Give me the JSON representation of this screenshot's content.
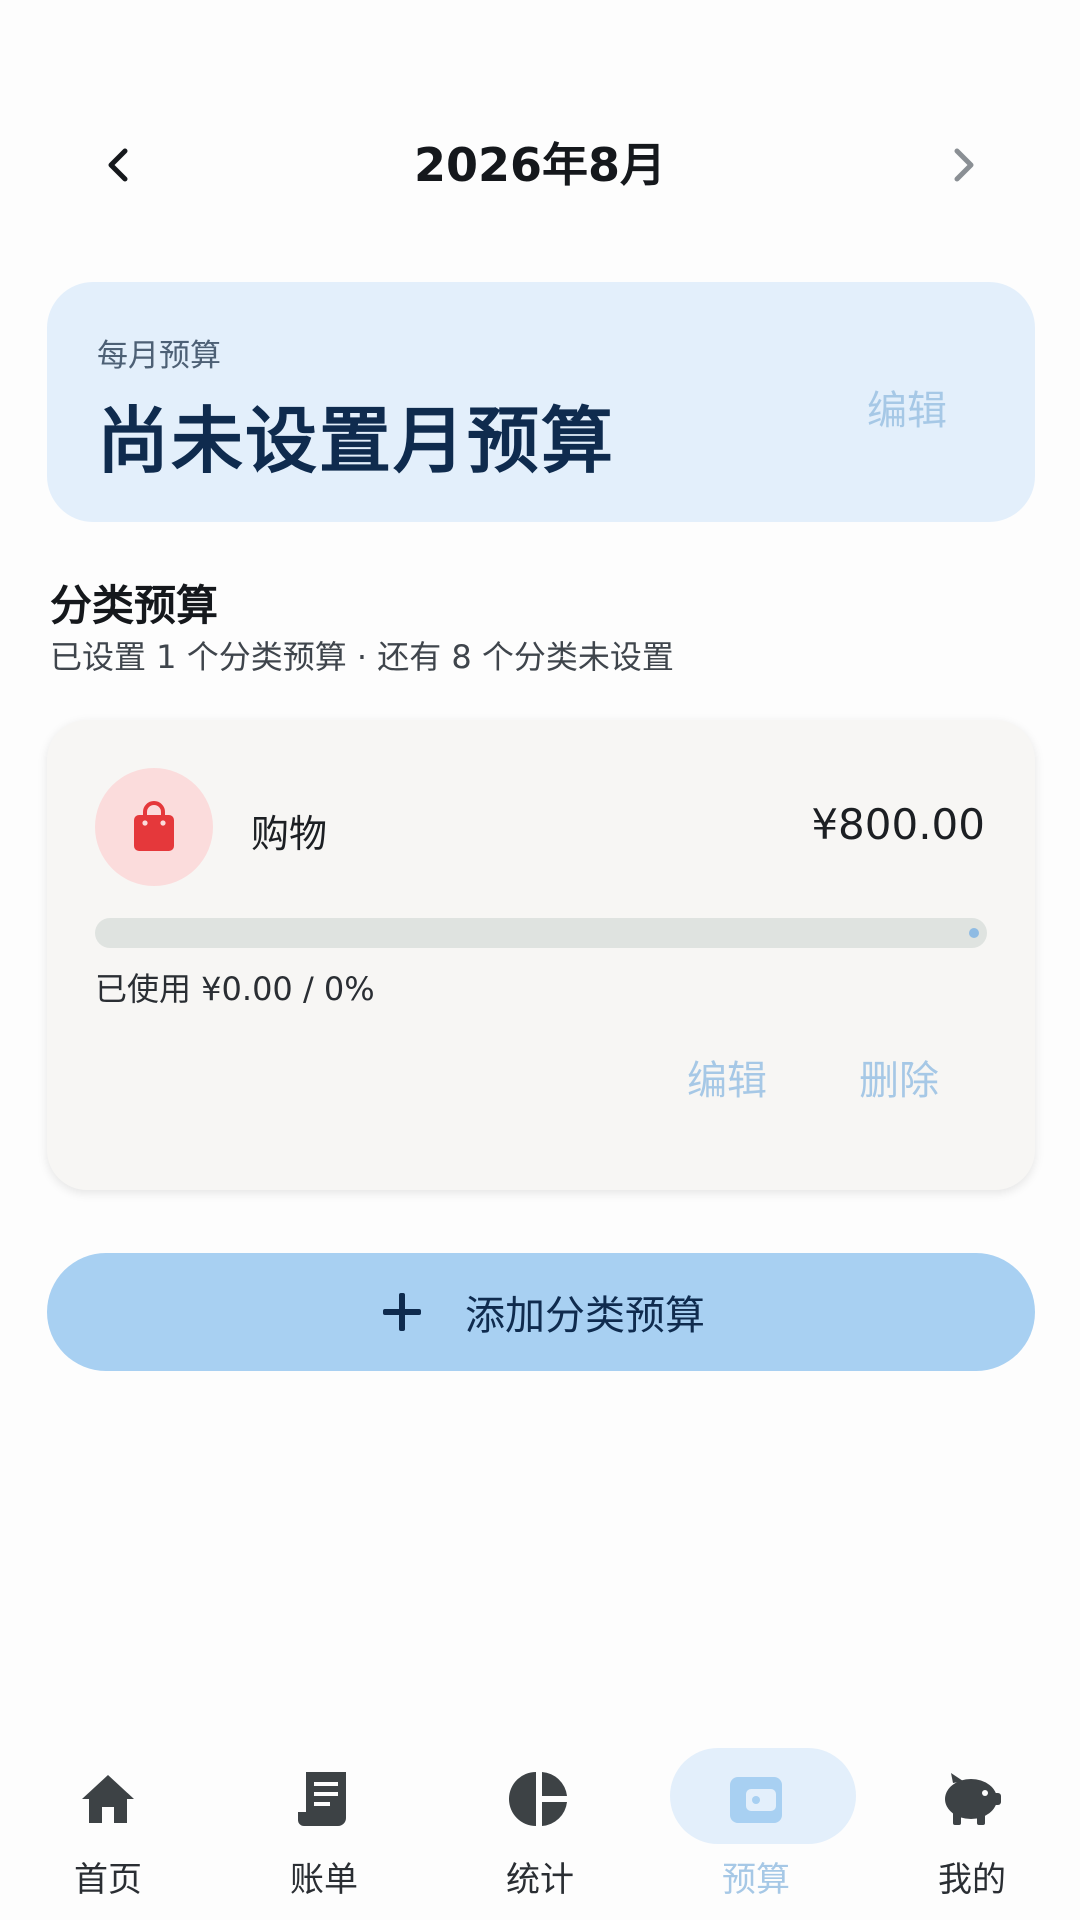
{
  "header": {
    "month_title": "2026年8月",
    "prev_icon": "chevron-left-icon",
    "next_icon": "chevron-right-icon"
  },
  "monthly_budget": {
    "label": "每月预算",
    "value": "尚未设置月预算",
    "edit_label": "编辑"
  },
  "category_section": {
    "title": "分类预算",
    "subtitle": "已设置 1 个分类预算 · 还有 8 个分类未设置"
  },
  "category_budgets": [
    {
      "icon": "shopping-bag-icon",
      "name": "购物",
      "amount": "¥800.00",
      "used_text": "已使用 ¥0.00 / 0%",
      "used_fraction": 0,
      "edit_label": "编辑",
      "delete_label": "删除"
    }
  ],
  "add_button": {
    "icon": "plus-icon",
    "label": "添加分类预算"
  },
  "tabbar": {
    "active": "budget",
    "items": [
      {
        "id": "home",
        "label": "首页",
        "icon": "home-icon"
      },
      {
        "id": "bills",
        "label": "账单",
        "icon": "receipt-icon"
      },
      {
        "id": "stats",
        "label": "统计",
        "icon": "pie-chart-icon"
      },
      {
        "id": "budget",
        "label": "预算",
        "icon": "wallet-icon"
      },
      {
        "id": "mine",
        "label": "我的",
        "icon": "piggy-bank-icon"
      }
    ]
  },
  "colors": {
    "accent": "#a8d0f2",
    "accent_text": "#a6c8e6",
    "card_blue": "#e3effb",
    "shopping_red": "#e5383b",
    "dark_navy": "#0f2b4e"
  }
}
